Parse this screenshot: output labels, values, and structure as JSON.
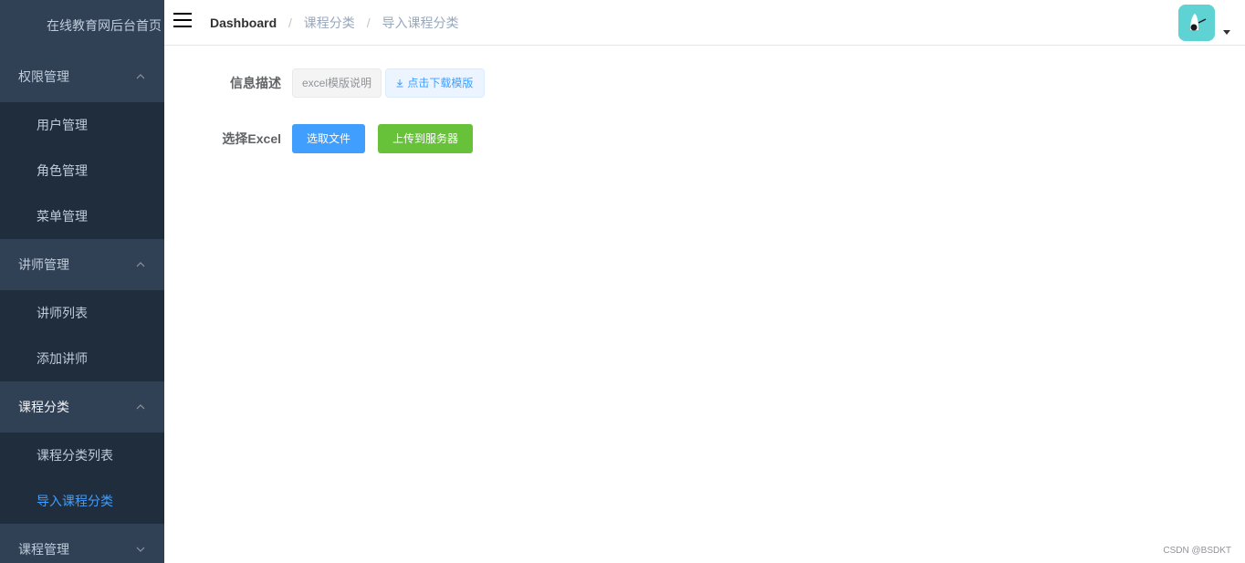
{
  "sidebar": {
    "logo_text": "在线教育网后台首页",
    "groups": [
      {
        "title": "权限管理",
        "items": [
          "用户管理",
          "角色管理",
          "菜单管理"
        ]
      },
      {
        "title": "讲师管理",
        "items": [
          "讲师列表",
          "添加讲师"
        ]
      },
      {
        "title": "课程分类",
        "items": [
          "课程分类列表",
          "导入课程分类"
        ]
      },
      {
        "title": "课程管理"
      }
    ]
  },
  "navbar": {
    "breadcrumb": [
      "Dashboard",
      "课程分类",
      "导入课程分类"
    ],
    "separator": "/"
  },
  "form": {
    "info_label": "信息描述",
    "info_tag": "excel模版说明",
    "download_link": "点击下载模版",
    "excel_label": "选择Excel",
    "select_file_button": "选取文件",
    "upload_button": "上传到服务器"
  },
  "footer": {
    "watermark": "CSDN @BSDKT"
  },
  "colors": {
    "sidebar_bg": "#304156",
    "submenu_bg": "#1f2d3d",
    "active_text": "#409eff",
    "primary": "#409eff",
    "success": "#67c23a",
    "avatar_bg": "#5fd3d4"
  },
  "icons": {
    "menu_toggle": "hamburger-icon",
    "expanded_arrow": "chevron-up-icon",
    "collapsed_arrow": "chevron-down-icon",
    "download": "download-icon",
    "dropdown": "caret-down-icon"
  }
}
